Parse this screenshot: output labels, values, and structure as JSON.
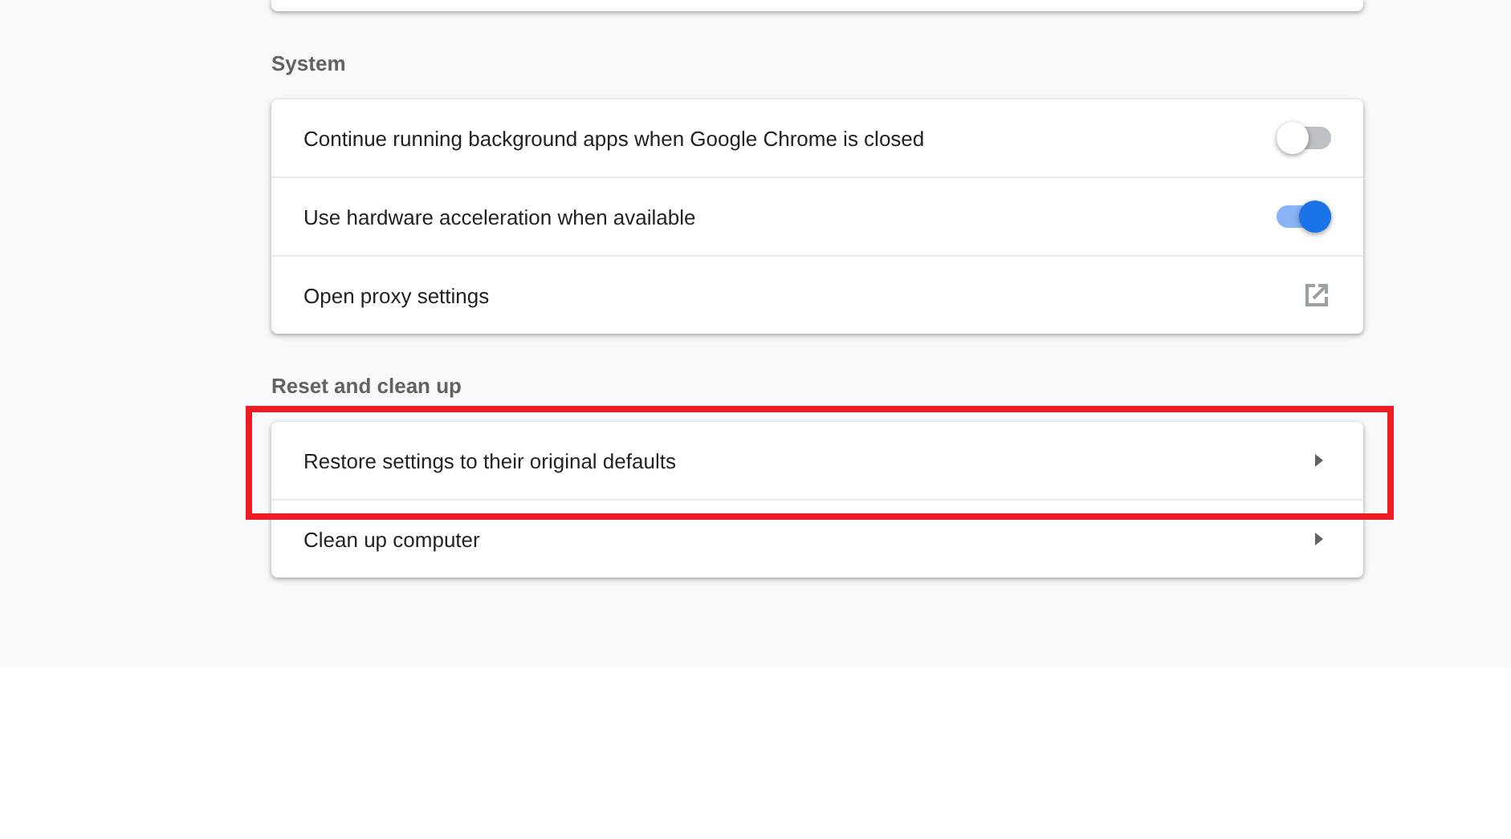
{
  "sections": [
    {
      "title": "System",
      "rows": [
        {
          "kind": "toggle",
          "label": "Continue running background apps when Google Chrome is closed",
          "on": false
        },
        {
          "kind": "toggle",
          "label": "Use hardware acceleration when available",
          "on": true
        },
        {
          "kind": "external",
          "label": "Open proxy settings"
        }
      ]
    },
    {
      "title": "Reset and clean up",
      "rows": [
        {
          "kind": "arrow",
          "label": "Restore settings to their original defaults",
          "highlighted": true
        },
        {
          "kind": "arrow",
          "label": "Clean up computer",
          "highlighted": false
        }
      ]
    }
  ]
}
